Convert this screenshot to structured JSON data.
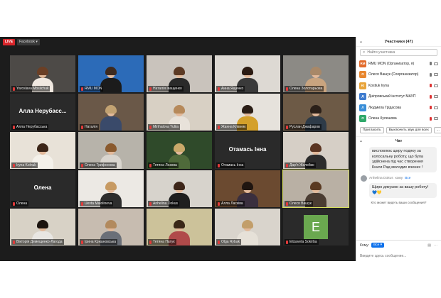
{
  "stream": {
    "live_label": "LIVE",
    "platform_label": "Facebook ▾"
  },
  "tiles": [
    {
      "label": "Yaroslava Mosiichuk",
      "kind": "video",
      "bg": "#4d4a47",
      "hair": "#6b3f25",
      "body": "#f0e8e0"
    },
    {
      "label": "RMU MON",
      "kind": "video",
      "bg": "#2c6bb8",
      "hair": "#3d2a1f",
      "body": "#1b1b1b"
    },
    {
      "label": "Наталія Іващенко",
      "kind": "video",
      "bg": "#c9c3bc",
      "hair": "#5c3a24",
      "body": "#2a2a2a"
    },
    {
      "label": "Анна Ященко",
      "kind": "video",
      "bg": "#ddd9d3",
      "hair": "#2b1b12",
      "body": "#3a3a3a"
    },
    {
      "label": "Олена Золотарьова",
      "kind": "video",
      "bg": "#8c8a85",
      "hair": "#a88868",
      "body": "#c9a47f"
    },
    {
      "label": "Алла Нерубасська",
      "kind": "name",
      "display": "Алла Нерубасс..."
    },
    {
      "label": "Наталія",
      "kind": "video",
      "bg": "#6a5848",
      "hair": "#c2a272",
      "body": "#3a4a6a"
    },
    {
      "label": "Mirihalova Yuliia",
      "kind": "video",
      "bg": "#d8d0c4",
      "hair": "#b6895a",
      "body": "#e8e2da"
    },
    {
      "label": "Жанна Клівняк",
      "kind": "video",
      "bg": "#e6e2dc",
      "hair": "#2a1d16",
      "body": "#d4a02a"
    },
    {
      "label": "Руслан Джафаров",
      "kind": "video",
      "bg": "#6d5a46",
      "hair": "#2b2019",
      "body": "#2e3b48"
    },
    {
      "label": "Iryna Kolnuk",
      "kind": "video",
      "bg": "#e8e2d8",
      "hair": "#3b2518",
      "body": "#f4f1ea"
    },
    {
      "label": "Олена Трифонова",
      "kind": "video",
      "bg": "#b7b3aa",
      "hair": "#8a5a2e",
      "body": "#d9d5ce"
    },
    {
      "label": "Тетяна Лозова",
      "kind": "video",
      "bg": "#2f4a2a",
      "hair": "#caa96a",
      "body": "#4f6a3a"
    },
    {
      "label": "Отамась Інна",
      "kind": "name",
      "display": "Отамась Інна"
    },
    {
      "label": "Дар'я Желейко",
      "kind": "video",
      "bg": "#d6cfc6",
      "hair": "#5a3421",
      "body": "#2c2c2c"
    },
    {
      "label": "Олена",
      "kind": "name",
      "display": "Олена"
    },
    {
      "label": "Uevta Malolineva",
      "kind": "video",
      "bg": "#ece9e4",
      "hair": "#c79a62",
      "body": "#2d2d2d"
    },
    {
      "label": "Anhelina Dokus",
      "kind": "video",
      "bg": "#d7d3cc",
      "hair": "#3d2619",
      "body": "#1f1f1f"
    },
    {
      "label": "Алла Ласківа",
      "kind": "video",
      "bg": "#6b4a30",
      "hair": "#1f1510",
      "body": "#3a2f3e"
    },
    {
      "label": "Олеся Вашук",
      "kind": "video",
      "bg": "#b9b0a4",
      "hair": "#5a3a22",
      "body": "#4a3c32",
      "active": true
    },
    {
      "label": "Вікторія Демещенко-Лагода",
      "kind": "video",
      "bg": "#d8d2c6",
      "hair": "#1b130e",
      "body": "#e8e6e2"
    },
    {
      "label": "Ірина Кржановська",
      "kind": "video",
      "bg": "#c7bcb0",
      "hair": "#b28a5e",
      "body": "#6a6f78"
    },
    {
      "label": "Тетяна Патук",
      "kind": "video",
      "bg": "#ccc29a",
      "hair": "#3a2718",
      "body": "#b04a4a"
    },
    {
      "label": "Olga Rybak",
      "kind": "video",
      "bg": "#d9d4cc",
      "hair": "#c29e6a",
      "body": "#e6e1d8"
    },
    {
      "label": "Elizaveta Sokirba",
      "kind": "avatar",
      "letter": "E"
    }
  ],
  "participants": {
    "title": "Участники (47)",
    "search_placeholder": "Найти участника",
    "list": [
      {
        "initials": "RM",
        "color": "#e26b2b",
        "name": "RMU MON (Организатор, я)",
        "mic_off": false
      },
      {
        "initials": "О",
        "color": "#e8872f",
        "name": "Олеся Вашук (Соорганизатор)",
        "mic_off": false
      },
      {
        "initials": "KI",
        "color": "#e8a43a",
        "name": "Kostiuk Iryna",
        "mic_off": true
      },
      {
        "initials": "Д",
        "color": "#3f7ccf",
        "name": "Дніпровський інститут МАУП",
        "mic_off": true
      },
      {
        "initials": "Л",
        "color": "#3a8fd8",
        "name": "Людмила Грідасова",
        "mic_off": true
      },
      {
        "initials": "О",
        "color": "#2fa86a",
        "name": "Олена Кулешова",
        "mic_off": true
      }
    ],
    "invite_label": "Пригласить",
    "mute_all_label": "Выключить звук для всех",
    "more_label": "..."
  },
  "chat": {
    "title": "Чат",
    "message1": "висловлює щиру подяку за колосальну роботу, що була здійснена під час створення Книги Рад молодих вчених !",
    "sender_name": "Anhelina Dokus",
    "sender_to_word": "кому",
    "sender_target": "Все",
    "message2": "Щиро дякуємо за вашу роботу!",
    "hearts": "💙💛",
    "who_sees": "Кто может видеть ваши сообщения?",
    "to_label": "Кому:",
    "to_value": "Все ▾",
    "input_placeholder": "Введите здесь сообщение..."
  }
}
